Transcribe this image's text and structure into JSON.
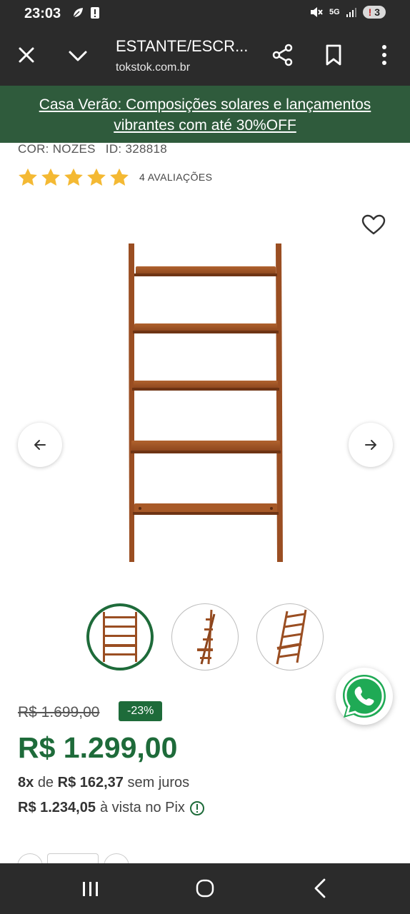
{
  "status_bar": {
    "time": "23:03",
    "network": "5G",
    "battery": "3",
    "icons": [
      "leaf-icon",
      "alert-icon",
      "mute-icon",
      "signal-icon"
    ]
  },
  "browser": {
    "title": "ESTANTE/ESCR...",
    "url": "tokstok.com.br",
    "icons": [
      "close-icon",
      "chevron-down-icon",
      "share-icon",
      "bookmark-icon",
      "more-vert-icon"
    ]
  },
  "promo": {
    "line1": "Casa Verão: Composições solares e lançamentos",
    "line2": "vibrantes com até 30%OFF",
    "color": "#2f5b3c"
  },
  "product": {
    "color_label": "COR: NOZES",
    "id_label": "ID: 328818",
    "rating": 5,
    "reviews": "4 AVALIAÇÕES",
    "thumbnails": [
      "front-view",
      "side-view",
      "angled-view"
    ],
    "active_thumbnail": 0
  },
  "pricing": {
    "old_price": "R$ 1.699,00",
    "discount": "-23%",
    "price": "R$ 1.299,00",
    "installments_count": "8x",
    "installments_de": "de",
    "installments_value": "R$ 162,37",
    "installments_suffix": "sem juros",
    "pix_value": "R$ 1.234,05",
    "pix_suffix": "à vista no Pix"
  },
  "colors": {
    "brand_green": "#1e6b3a",
    "star": "#f4b933",
    "wood": "#9a4e22"
  }
}
